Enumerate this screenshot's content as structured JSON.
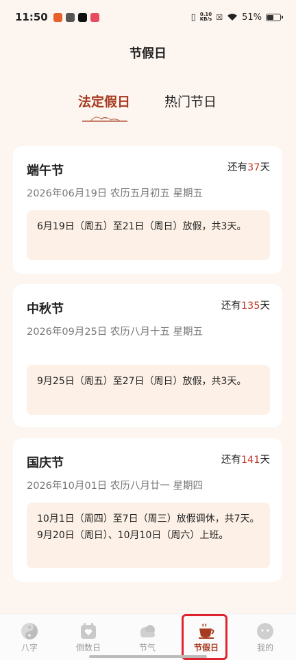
{
  "status": {
    "time": "11:50",
    "net_speed_value": "0.10",
    "net_speed_unit": "KB/s",
    "battery": "51%"
  },
  "title": "节假日",
  "tabs": [
    {
      "label": "法定假日",
      "active": true
    },
    {
      "label": "热门节日",
      "active": false
    }
  ],
  "holidays": [
    {
      "name": "端午节",
      "countdown_prefix": "还有",
      "days": "37",
      "countdown_suffix": "天",
      "date": "2026年06月19日  农历五月初五  星期五",
      "note": "6月19日（周五）至21日（周日）放假，共3天。"
    },
    {
      "name": "中秋节",
      "countdown_prefix": "还有",
      "days": "135",
      "countdown_suffix": "天",
      "date": "2026年09月25日  农历八月十五  星期五",
      "note": "9月25日（周五）至27日（周日）放假，共3天。"
    },
    {
      "name": "国庆节",
      "countdown_prefix": "还有",
      "days": "141",
      "countdown_suffix": "天",
      "date": "2026年10月01日  农历八月廿一  星期四",
      "note": "10月1日（周四）至7日（周三）放假调休，共7天。9月20日（周日）、10月10日（周六）上班。"
    }
  ],
  "nav": [
    {
      "label": "八字",
      "icon": "yin-yang-icon",
      "active": false
    },
    {
      "label": "倒数日",
      "icon": "calendar-heart-icon",
      "active": false
    },
    {
      "label": "节气",
      "icon": "cloud-icon",
      "active": false
    },
    {
      "label": "节假日",
      "icon": "tea-cup-icon",
      "active": true
    },
    {
      "label": "我的",
      "icon": "profile-face-icon",
      "active": false
    }
  ],
  "colors": {
    "accent": "#a63b1f",
    "countdown": "#c0392b",
    "background": "#fdf6f0",
    "note_bg": "#fdf1e7"
  }
}
